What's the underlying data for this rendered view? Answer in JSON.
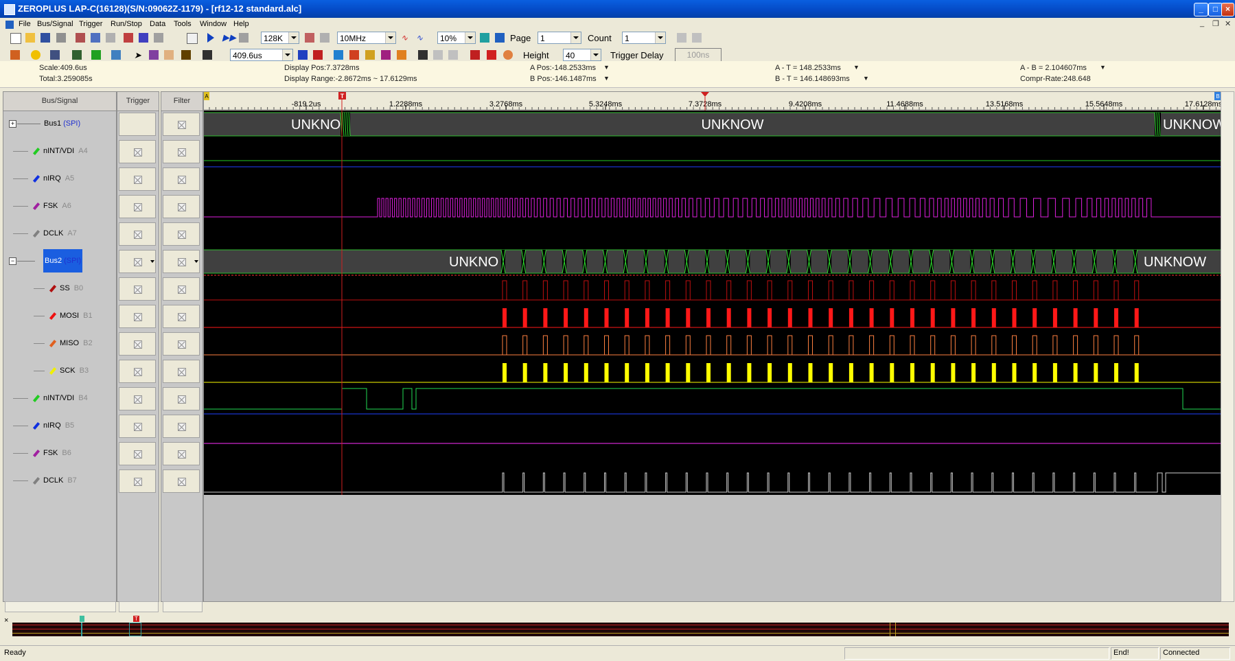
{
  "window": {
    "title": "ZEROPLUS LAP-C(16128)(S/N:09062Z-1179) - [rf12-12 standard.alc]"
  },
  "menu": [
    "File",
    "Bus/Signal",
    "Trigger",
    "Run/Stop",
    "Data",
    "Tools",
    "Window",
    "Help"
  ],
  "toolbar1": {
    "memory": "128K",
    "sample_rate": "10MHz",
    "trigger_pos": "10%",
    "page_label": "Page",
    "page_value": "1",
    "count_label": "Count",
    "count_value": "1"
  },
  "toolbar2": {
    "scale_value": "409.6us",
    "height_label": "Height",
    "height_value": "40",
    "trigger_delay_label": "Trigger Delay",
    "trigger_delay_value": "100ns"
  },
  "info": {
    "scale": "Scale:409.6us",
    "total": "Total:3.259085s",
    "display_pos": "Display Pos:7.3728ms",
    "display_range": "Display Range:-2.8672ms ~ 17.6129ms",
    "a_pos": "A Pos:-148.2533ms",
    "b_pos": "B Pos:-146.1487ms",
    "a_minus_t": "A - T = 148.2533ms",
    "b_minus_t": "B - T = 146.148693ms",
    "a_minus_b": "A - B = 2.104607ms",
    "compr_rate": "Compr-Rate:248.648"
  },
  "panels": {
    "bus_signal": "Bus/Signal",
    "trigger": "Trigger",
    "filter": "Filter"
  },
  "signals": [
    {
      "name": "Bus1",
      "type": "(SPI)",
      "kind": "bus",
      "color": "#000000"
    },
    {
      "name": "nINT/VDI",
      "ch": "A4",
      "kind": "sig",
      "color": "#22cc22"
    },
    {
      "name": "nIRQ",
      "ch": "A5",
      "kind": "sig",
      "color": "#1030e0"
    },
    {
      "name": "FSK",
      "ch": "A6",
      "kind": "sig",
      "color": "#a020a0"
    },
    {
      "name": "DCLK",
      "ch": "A7",
      "kind": "sig",
      "color": "#808080"
    },
    {
      "name": "Bus2",
      "type": "(SPI)",
      "kind": "bus",
      "color": "#000000"
    },
    {
      "name": "SS",
      "ch": "B0",
      "kind": "sub",
      "color": "#b01010"
    },
    {
      "name": "MOSI",
      "ch": "B1",
      "kind": "sub",
      "color": "#ee1010"
    },
    {
      "name": "MISO",
      "ch": "B2",
      "kind": "sub",
      "color": "#e06020"
    },
    {
      "name": "SCK",
      "ch": "B3",
      "kind": "sub",
      "color": "#f0f000"
    },
    {
      "name": "nINT/VDI",
      "ch": "B4",
      "kind": "sig",
      "color": "#22cc22"
    },
    {
      "name": "nIRQ",
      "ch": "B5",
      "kind": "sig",
      "color": "#1030e0"
    },
    {
      "name": "FSK",
      "ch": "B6",
      "kind": "sig",
      "color": "#a020a0"
    },
    {
      "name": "DCLK",
      "ch": "B7",
      "kind": "sig",
      "color": "#808080"
    }
  ],
  "time_labels": [
    "-819.2us",
    "1.2288ms",
    "3.2768ms",
    "5.3248ms",
    "7.3728ms",
    "9.4208ms",
    "11.4688ms",
    "13.5168ms",
    "15.5648ms",
    "17.6128ms"
  ],
  "decode_labels": {
    "unknow_a": "UNKNO",
    "unknow_b": "UNKNOW",
    "unknow_c": "UNKNOW",
    "unknow_d": "UNKNO",
    "unknow_e": "UNKNOW"
  },
  "markers": {
    "trigger": "T",
    "cursor_a": "A",
    "cursor_b": "B"
  },
  "status": {
    "ready": "Ready",
    "end": "End!",
    "connected": "Connected"
  }
}
